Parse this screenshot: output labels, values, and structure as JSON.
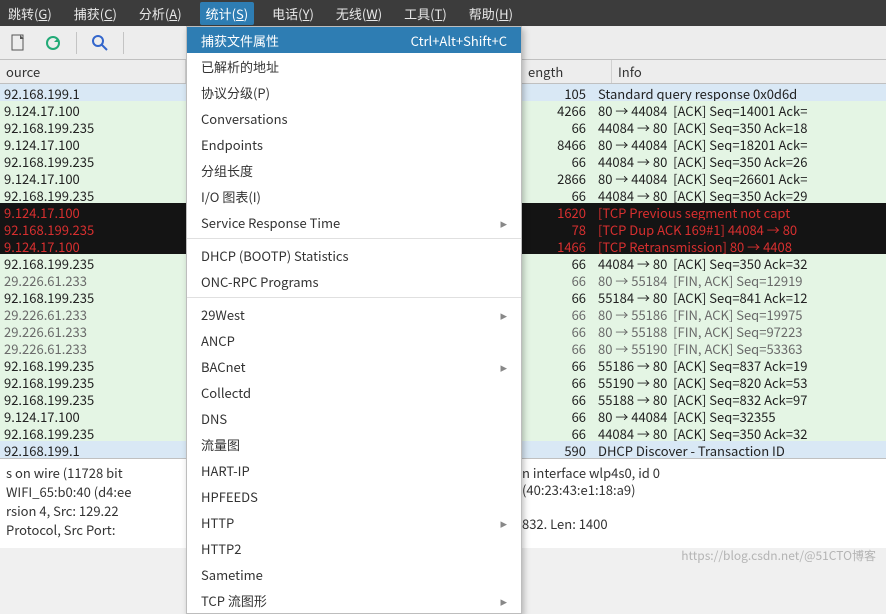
{
  "menubar": {
    "items": [
      {
        "pre": "跳转(",
        "u": "G",
        "post": ")"
      },
      {
        "pre": "捕获(",
        "u": "C",
        "post": ")"
      },
      {
        "pre": "分析(",
        "u": "A",
        "post": ")"
      },
      {
        "pre": "统计(",
        "u": "S",
        "post": ")",
        "active": true
      },
      {
        "pre": "电话(",
        "u": "Y",
        "post": ")"
      },
      {
        "pre": "无线(",
        "u": "W",
        "post": ")"
      },
      {
        "pre": "工具(",
        "u": "T",
        "post": ")"
      },
      {
        "pre": "帮助(",
        "u": "H",
        "post": ")"
      }
    ]
  },
  "columns": {
    "source": "ource",
    "length": "ength",
    "info": "Info"
  },
  "popup": {
    "items": [
      {
        "label": "捕获文件属性",
        "shortcut": "Ctrl+Alt+Shift+C",
        "selected": true
      },
      {
        "label": "已解析的地址"
      },
      {
        "label": "协议分级(P)"
      },
      {
        "label": "Conversations"
      },
      {
        "label": "Endpoints"
      },
      {
        "label": "分组长度"
      },
      {
        "label": "I/O 图表(I)"
      },
      {
        "label": "Service Response Time",
        "sub": true
      },
      {
        "sep": true
      },
      {
        "label": "DHCP (BOOTP) Statistics"
      },
      {
        "label": "ONC-RPC Programs"
      },
      {
        "sep": true
      },
      {
        "label": "29West",
        "sub": true
      },
      {
        "label": "ANCP"
      },
      {
        "label": "BACnet",
        "sub": true
      },
      {
        "label": "Collectd"
      },
      {
        "label": "DNS"
      },
      {
        "label": "流量图"
      },
      {
        "label": "HART-IP"
      },
      {
        "label": "HPFEEDS"
      },
      {
        "label": "HTTP",
        "sub": true
      },
      {
        "label": "HTTP2"
      },
      {
        "label": "Sametime"
      },
      {
        "label": "TCP 流图形",
        "sub": true
      }
    ]
  },
  "packets": [
    {
      "cls": "dns",
      "src": "92.168.199.1",
      "len": "105",
      "info": "Standard query response 0x0d6d"
    },
    {
      "cls": "green",
      "src": "9.124.17.100",
      "len": "4266",
      "info": "80 → 44084  [ACK] Seq=14001 Ack="
    },
    {
      "cls": "green",
      "src": "92.168.199.235",
      "len": "66",
      "info": "44084 → 80  [ACK] Seq=350 Ack=18"
    },
    {
      "cls": "green",
      "src": "9.124.17.100",
      "len": "8466",
      "info": "80 → 44084  [ACK] Seq=18201 Ack="
    },
    {
      "cls": "green",
      "src": "92.168.199.235",
      "len": "66",
      "info": "44084 → 80  [ACK] Seq=350 Ack=26"
    },
    {
      "cls": "green",
      "src": "9.124.17.100",
      "len": "2866",
      "info": "80 → 44084  [ACK] Seq=26601 Ack="
    },
    {
      "cls": "green",
      "src": "92.168.199.235",
      "len": "66",
      "info": "44084 → 80  [ACK] Seq=350 Ack=29"
    },
    {
      "cls": "black",
      "src": "9.124.17.100",
      "len": "1620",
      "info": "[TCP Previous segment not capt"
    },
    {
      "cls": "black",
      "src": "92.168.199.235",
      "len": "78",
      "info": "[TCP Dup ACK 169#1] 44084 → 80"
    },
    {
      "cls": "black",
      "src": "9.124.17.100",
      "len": "1466",
      "info": "[TCP Retransmission] 80 → 4408"
    },
    {
      "cls": "green",
      "src": "92.168.199.235",
      "len": "66",
      "info": "44084 → 80  [ACK] Seq=350 Ack=32"
    },
    {
      "cls": "fin",
      "src": "29.226.61.233",
      "len": "66",
      "info": "80 → 55184  [FIN, ACK] Seq=12919"
    },
    {
      "cls": "green",
      "src": "92.168.199.235",
      "len": "66",
      "info": "55184 → 80  [ACK] Seq=841 Ack=12"
    },
    {
      "cls": "fin",
      "src": "29.226.61.233",
      "len": "66",
      "info": "80 → 55186  [FIN, ACK] Seq=19975"
    },
    {
      "cls": "fin",
      "src": "29.226.61.233",
      "len": "66",
      "info": "80 → 55188  [FIN, ACK] Seq=97223"
    },
    {
      "cls": "fin",
      "src": "29.226.61.233",
      "len": "66",
      "info": "80 → 55190  [FIN, ACK] Seq=53363"
    },
    {
      "cls": "green",
      "src": "92.168.199.235",
      "len": "66",
      "info": "55186 → 80  [ACK] Seq=837 Ack=19"
    },
    {
      "cls": "green",
      "src": "92.168.199.235",
      "len": "66",
      "info": "55190 → 80  [ACK] Seq=820 Ack=53"
    },
    {
      "cls": "green",
      "src": "92.168.199.235",
      "len": "66",
      "info": "55188 → 80  [ACK] Seq=832 Ack=97"
    },
    {
      "cls": "green",
      "src": "9.124.17.100",
      "len": "66",
      "info": "80 → 44084  [ACK] Seq=32355"
    },
    {
      "cls": "green",
      "src": "92.168.199.235",
      "len": "66",
      "info": "44084 → 80  [ACK] Seq=350 Ack=32"
    },
    {
      "cls": "dhcp",
      "src": "92.168.199.1",
      "len": "590",
      "info": "DHCP Discover - Transaction ID"
    }
  ],
  "detail": {
    "l0": "s on wire (11728 bit",
    "l1": "WIFI_65:b0:40 (d4:ee",
    "l2": "rsion 4, Src: 129.22",
    "l3": " Protocol, Src Port:",
    "r0": "n interface wlp4s0, id 0",
    "r1": "(40:23:43:e1:18:a9)",
    "r3": " 832. Len: 1400"
  },
  "watermark": "https://blog.csdn.net/@51CTO博客"
}
